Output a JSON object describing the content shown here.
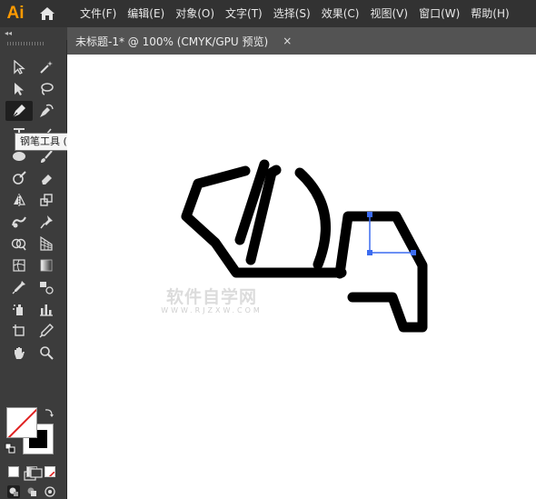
{
  "app": {
    "logo": "Ai",
    "home_icon": "home-icon"
  },
  "menu": {
    "items": [
      {
        "label": "文件(F)"
      },
      {
        "label": "编辑(E)"
      },
      {
        "label": "对象(O)"
      },
      {
        "label": "文字(T)"
      },
      {
        "label": "选择(S)"
      },
      {
        "label": "效果(C)"
      },
      {
        "label": "视图(V)"
      },
      {
        "label": "窗口(W)"
      },
      {
        "label": "帮助(H)"
      }
    ]
  },
  "panel": {
    "collapse_label": "◂◂"
  },
  "document_tab": {
    "title": "未标题-1* @ 100% (CMYK/GPU 预览)",
    "close_label": "×"
  },
  "tooltip": {
    "text": "钢笔工具 (P)"
  },
  "toolbar": {
    "active_tool": "pen-icon",
    "tools": [
      "selection-arrow-icon",
      "magic-wand-icon",
      "direct-selection-icon",
      "lasso-icon",
      "pen-icon",
      "curvature-icon",
      "type-icon",
      "line-icon",
      "ellipse-icon",
      "paintbrush-icon",
      "shaper-icon",
      "eraser-icon",
      "reflect-icon",
      "scale-icon",
      "warp-icon",
      "puppet-warp-icon",
      "shape-builder-icon",
      "perspective-grid-icon",
      "mesh-icon",
      "gradient-icon",
      "eyedropper-icon",
      "blend-icon",
      "symbol-sprayer-icon",
      "column-graph-icon",
      "artboard-icon",
      "slice-icon",
      "hand-icon",
      "zoom-icon"
    ]
  },
  "colors": {
    "fill": "#ffffff",
    "stroke": "#000000",
    "none_slash": "#e02020",
    "anchor_point": "#3c6cf0",
    "accent_logo": "#ff9a00"
  },
  "watermark": {
    "main": "软件自学网",
    "sub": "WWW.RJZXW.COM"
  }
}
